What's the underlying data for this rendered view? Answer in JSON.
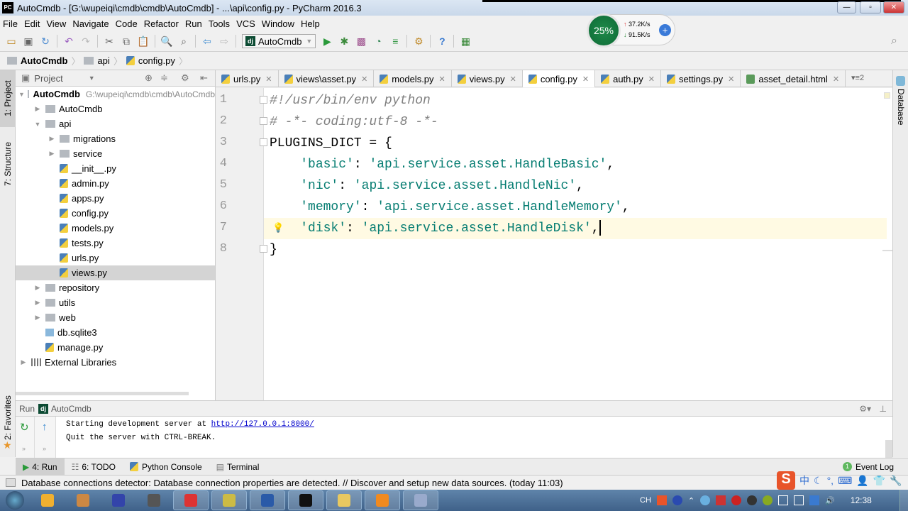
{
  "window": {
    "title": "AutoCmdb - [G:\\wupeiqi\\cmdb\\cmdb\\AutoCmdb] - ...\\api\\config.py - PyCharm 2016.3",
    "app_icon": "PC"
  },
  "menu": [
    "File",
    "Edit",
    "View",
    "Navigate",
    "Code",
    "Refactor",
    "Run",
    "Tools",
    "VCS",
    "Window",
    "Help"
  ],
  "toolbar": {
    "run_config": "AutoCmdb"
  },
  "breadcrumb": [
    "AutoCmdb",
    "api",
    "config.py"
  ],
  "net_widget": {
    "cpu": "25%",
    "upload": "37.2K/s",
    "download": "91.5K/s"
  },
  "left_strip": {
    "project": "1: Project",
    "structure": "7: Structure",
    "favorites": "2: Favorites"
  },
  "right_strip": {
    "database": "Database"
  },
  "project_panel": {
    "title": "Project",
    "tree": [
      {
        "label": "AutoCmdb",
        "path": "G:\\wupeiqi\\cmdb\\cmdb\\AutoCmdb",
        "type": "folder",
        "level": 0,
        "expanded": true,
        "bold": true
      },
      {
        "label": "AutoCmdb",
        "type": "folder",
        "level": 1,
        "expanded": false
      },
      {
        "label": "api",
        "type": "folder",
        "level": 1,
        "expanded": true
      },
      {
        "label": "migrations",
        "type": "folder",
        "level": 2,
        "expanded": false
      },
      {
        "label": "service",
        "type": "folder",
        "level": 2,
        "expanded": false
      },
      {
        "label": "__init__.py",
        "type": "py",
        "level": 2
      },
      {
        "label": "admin.py",
        "type": "py",
        "level": 2
      },
      {
        "label": "apps.py",
        "type": "py",
        "level": 2
      },
      {
        "label": "config.py",
        "type": "py",
        "level": 2
      },
      {
        "label": "models.py",
        "type": "py",
        "level": 2
      },
      {
        "label": "tests.py",
        "type": "py",
        "level": 2
      },
      {
        "label": "urls.py",
        "type": "py",
        "level": 2
      },
      {
        "label": "views.py",
        "type": "py",
        "level": 2,
        "selected": true
      },
      {
        "label": "repository",
        "type": "folder",
        "level": 1,
        "expanded": false
      },
      {
        "label": "utils",
        "type": "folder",
        "level": 1,
        "expanded": false
      },
      {
        "label": "web",
        "type": "folder",
        "level": 1,
        "expanded": false
      },
      {
        "label": "db.sqlite3",
        "type": "db",
        "level": 1
      },
      {
        "label": "manage.py",
        "type": "py",
        "level": 1
      },
      {
        "label": "External Libraries",
        "type": "lib",
        "level": 0,
        "expanded": false
      }
    ]
  },
  "tabs": [
    {
      "label": "urls.py",
      "type": "py"
    },
    {
      "label": "views\\asset.py",
      "type": "py"
    },
    {
      "label": "models.py",
      "type": "py"
    },
    {
      "label": "views.py",
      "type": "py"
    },
    {
      "label": "config.py",
      "type": "py",
      "active": true
    },
    {
      "label": "auth.py",
      "type": "py"
    },
    {
      "label": "settings.py",
      "type": "py"
    },
    {
      "label": "asset_detail.html",
      "type": "html"
    }
  ],
  "tabs_overflow": "2",
  "editor": {
    "lines": [
      {
        "num": "1",
        "parts": [
          {
            "t": "#!/usr/bin/env python",
            "c": "cmt"
          }
        ]
      },
      {
        "num": "2",
        "parts": [
          {
            "t": "# -*- coding:utf-8 -*-",
            "c": "cmt"
          }
        ]
      },
      {
        "num": "3",
        "parts": [
          {
            "t": "PLUGINS_DICT = {",
            "c": ""
          }
        ]
      },
      {
        "num": "4",
        "parts": [
          {
            "t": "    ",
            "c": ""
          },
          {
            "t": "'basic'",
            "c": "str"
          },
          {
            "t": ": ",
            "c": ""
          },
          {
            "t": "'api.service.asset.HandleBasic'",
            "c": "str"
          },
          {
            "t": ",",
            "c": ""
          }
        ]
      },
      {
        "num": "5",
        "parts": [
          {
            "t": "    ",
            "c": ""
          },
          {
            "t": "'nic'",
            "c": "str"
          },
          {
            "t": ": ",
            "c": ""
          },
          {
            "t": "'api.service.asset.HandleNic'",
            "c": "str"
          },
          {
            "t": ",",
            "c": ""
          }
        ]
      },
      {
        "num": "6",
        "parts": [
          {
            "t": "    ",
            "c": ""
          },
          {
            "t": "'memory'",
            "c": "str"
          },
          {
            "t": ": ",
            "c": ""
          },
          {
            "t": "'api.service.asset.HandleMemory'",
            "c": "str"
          },
          {
            "t": ",",
            "c": ""
          }
        ]
      },
      {
        "num": "7",
        "parts": [
          {
            "t": "    ",
            "c": ""
          },
          {
            "t": "'disk'",
            "c": "str"
          },
          {
            "t": ": ",
            "c": ""
          },
          {
            "t": "'api.service.asset.HandleDisk'",
            "c": "str"
          },
          {
            "t": ",",
            "c": ""
          }
        ],
        "current": true
      },
      {
        "num": "8",
        "parts": [
          {
            "t": "}",
            "c": ""
          }
        ]
      }
    ]
  },
  "run_panel": {
    "label": "Run",
    "config": "AutoCmdb",
    "output_prefix": "Starting development server at ",
    "output_link": "http://127.0.0.1:8000/",
    "output_line2": "Quit the server with CTRL-BREAK."
  },
  "bottom_tabs": [
    {
      "label": "4: Run",
      "active": true
    },
    {
      "label": "6: TODO"
    },
    {
      "label": "Python Console"
    },
    {
      "label": "Terminal"
    }
  ],
  "event_log": {
    "count": "1",
    "label": "Event Log"
  },
  "status": {
    "message": "Database connections detector: Database connection properties are detected. // Discover and setup new data sources. (today 11:03)"
  },
  "ime": {
    "mode": "中"
  },
  "taskbar": {
    "lang": "CH",
    "clock": "12:38",
    "apps": [
      "paint",
      "tools",
      "save",
      "usb",
      "chrome",
      "notepad",
      "word",
      "pycharm",
      "file-explorer",
      "orange-app",
      "paint2"
    ]
  },
  "colors": {
    "string": "#067d72",
    "comment": "#808080",
    "current_line": "#fffae3",
    "link": "#0000cc"
  }
}
